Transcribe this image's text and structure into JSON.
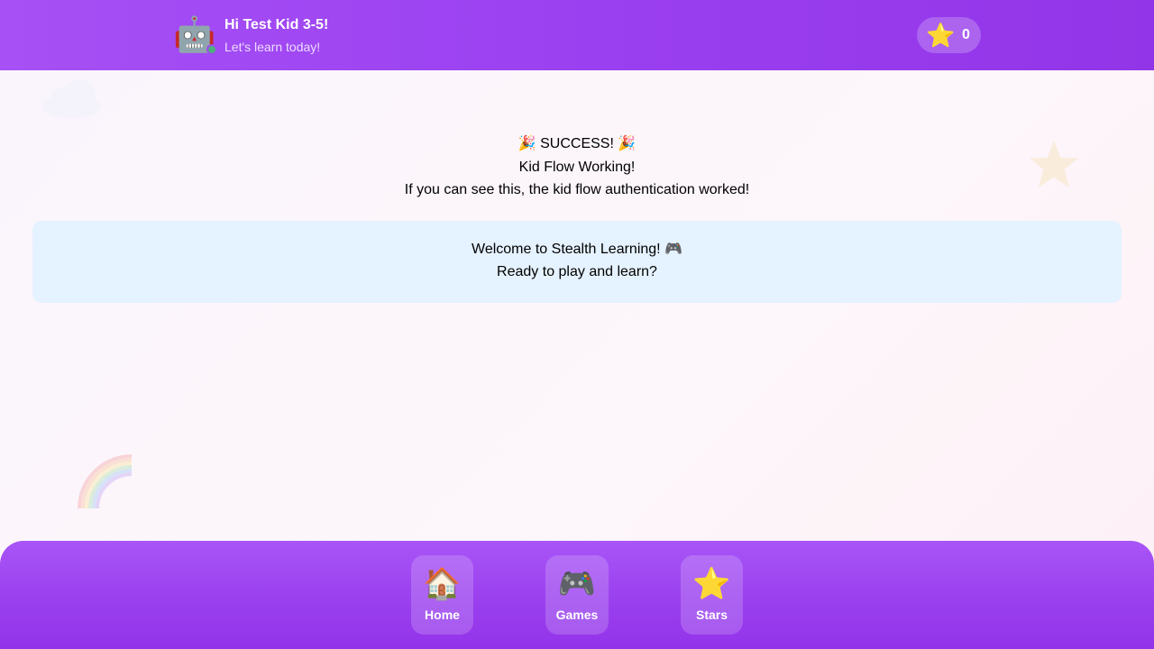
{
  "header": {
    "avatar_emoji": "🤖",
    "greeting": "Hi Test Kid 3-5!",
    "subtitle": "Let's learn today!",
    "stars": {
      "icon": "⭐",
      "count": "0"
    }
  },
  "main": {
    "success_title": "🎉 SUCCESS! 🎉",
    "flow_status": "Kid Flow Working!",
    "auth_message": "If you can see this, the kid flow authentication worked!",
    "welcome": {
      "line1": "Welcome to Stealth Learning! 🎮",
      "line2": "Ready to play and learn?"
    }
  },
  "bottom_nav": {
    "items": [
      {
        "icon": "🏠",
        "label": "Home"
      },
      {
        "icon": "🎮",
        "label": "Games"
      },
      {
        "icon": "⭐",
        "label": "Stars"
      }
    ]
  },
  "colors": {
    "header_purple": "#a650f5",
    "nav_purple": "#9333ea",
    "welcome_box": "#e5f2ff",
    "online_dot": "#4caf7d"
  },
  "icons": {
    "avatar": "robot-icon",
    "stars": "star-icon",
    "decorations": [
      "cloud-icon",
      "star-icon",
      "rainbow-icon"
    ]
  }
}
